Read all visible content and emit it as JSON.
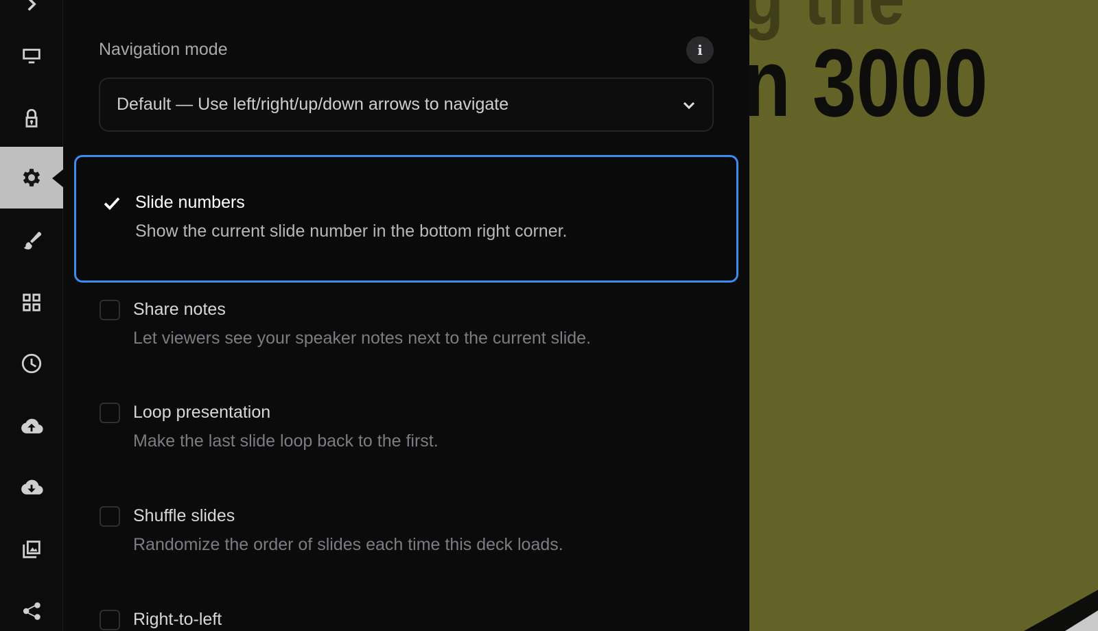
{
  "sidebar": {
    "items": [
      {
        "icon": "monitor-icon",
        "active": false
      },
      {
        "icon": "lock-icon",
        "active": false
      },
      {
        "icon": "gear-icon",
        "active": true
      },
      {
        "icon": "brush-icon",
        "active": false
      },
      {
        "icon": "grid-icon",
        "active": false
      },
      {
        "icon": "clock-icon",
        "active": false
      },
      {
        "icon": "cloud-upload-icon",
        "active": false
      },
      {
        "icon": "cloud-download-icon",
        "active": false
      },
      {
        "icon": "images-icon",
        "active": false
      },
      {
        "icon": "share-icon",
        "active": false
      }
    ]
  },
  "navigation": {
    "label": "Navigation mode",
    "info_icon": "i",
    "selected": "Default — Use left/right/up/down arrows to navigate"
  },
  "options": [
    {
      "title": "Slide numbers",
      "description": "Show the current slide number in the bottom right corner.",
      "checked": true
    },
    {
      "title": "Share notes",
      "description": "Let viewers see your speaker notes next to the current slide.",
      "checked": false
    },
    {
      "title": "Loop presentation",
      "description": "Make the last slide loop back to the first.",
      "checked": false
    },
    {
      "title": "Shuffle slides",
      "description": "Randomize the order of slides each time this deck loads.",
      "checked": false
    },
    {
      "title": "Right-to-left",
      "description": "",
      "checked": false
    }
  ],
  "preview": {
    "line1": "g the",
    "line2": "n 3000"
  },
  "colors": {
    "accent": "#3b8cf0",
    "preview_bg": "#636227"
  }
}
